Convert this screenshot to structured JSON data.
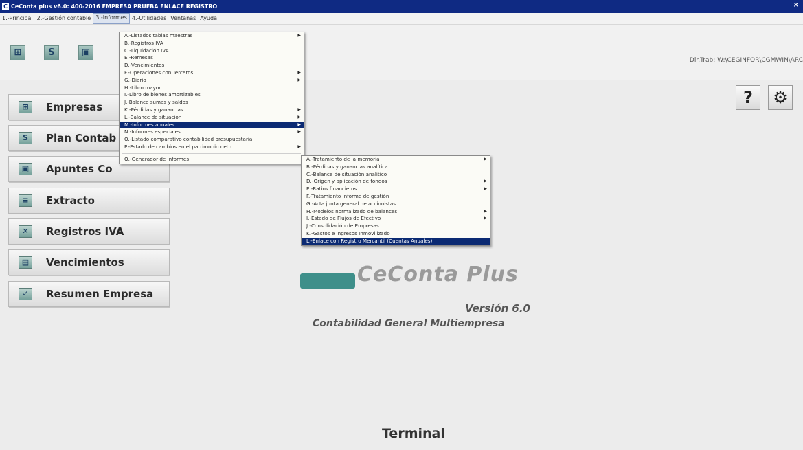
{
  "window": {
    "title": "CeConta plus v6.0: 400-2016 EMPRESA PRUEBA ENLACE REGISTRO",
    "icon_letter": "C",
    "close": "×"
  },
  "menubar": [
    "1.-Principal",
    "2.-Gestión contable",
    "3.-Informes",
    "4.-Utilidades",
    "Ventanas",
    "Ayuda"
  ],
  "toolbar": {
    "buttons": [
      {
        "icon": "empresas-icon",
        "glyph": "⊞"
      },
      {
        "icon": "plan-contable-icon",
        "glyph": "S"
      },
      {
        "icon": "apuntes-icon",
        "glyph": "▣"
      }
    ],
    "dir_trab": "Dir.Trab: W:\\CEGINFOR\\CGMWIN\\ARC"
  },
  "sidebar": [
    {
      "label": "Empresas",
      "icon": "empresas-icon",
      "glyph": "⊞"
    },
    {
      "label": "Plan Contab",
      "icon": "plan-contable-icon",
      "glyph": "S"
    },
    {
      "label": "Apuntes Co",
      "icon": "apuntes-icon",
      "glyph": "▣"
    },
    {
      "label": "Extracto",
      "icon": "extracto-icon",
      "glyph": "≡"
    },
    {
      "label": "Registros IVA",
      "icon": "registros-iva-icon",
      "glyph": "✕"
    },
    {
      "label": "Vencimientos",
      "icon": "vencimientos-icon",
      "glyph": "▤"
    },
    {
      "label": "Resumen Empresa",
      "icon": "resumen-icon",
      "glyph": "✓"
    }
  ],
  "top_right": [
    {
      "icon": "help-icon",
      "glyph": "?"
    },
    {
      "icon": "settings-icon",
      "glyph": "⚙"
    }
  ],
  "branding": {
    "logo_text": "CeConta Plus",
    "version": "Versión 6.0",
    "subtitle": "Contabilidad General Multiempresa",
    "terminal": "Terminal"
  },
  "informes_menu": {
    "items": [
      {
        "label": "A.-Listados tablas maestras",
        "submenu": true
      },
      {
        "label": "B.-Registros IVA",
        "submenu": false
      },
      {
        "label": "C.-Liquidación IVA",
        "submenu": false
      },
      {
        "label": "E.-Remesas",
        "submenu": false
      },
      {
        "label": "D.-Vencimientos",
        "submenu": false
      },
      {
        "label": "F.-Operaciones con Terceros",
        "submenu": true
      },
      {
        "label": "G.-Diario",
        "submenu": true
      },
      {
        "label": "H.-Libro mayor",
        "submenu": false
      },
      {
        "label": "I.-Libro de bienes amortizables",
        "submenu": false
      },
      {
        "label": "J.-Balance sumas y saldos",
        "submenu": false
      },
      {
        "label": "K.-Pérdidas y ganancias",
        "submenu": true
      },
      {
        "label": "L.-Balance de situación",
        "submenu": true
      },
      {
        "label": "M.-Informes anuales",
        "submenu": true,
        "selected": true
      },
      {
        "label": "N.-Informes especiales",
        "submenu": true
      },
      {
        "label": "O.-Listado comparativo contabilidad presupuestaria",
        "submenu": false
      },
      {
        "label": "P.-Estado de cambios en el patrimonio neto",
        "submenu": true
      }
    ],
    "footer": "Q.-Generador de informes"
  },
  "anuales_menu": {
    "items": [
      {
        "label": "A.-Tratamiento de la memoria",
        "submenu": true
      },
      {
        "label": "B.-Pérdidas y ganancias analítica",
        "submenu": false
      },
      {
        "label": "C.-Balance de situación analítico",
        "submenu": false
      },
      {
        "label": "D.-Origen y aplicación de fondos",
        "submenu": true
      },
      {
        "label": "E.-Ratios financieros",
        "submenu": true
      },
      {
        "label": "F.-Tratamiento informe de gestión",
        "submenu": false
      },
      {
        "label": "G.-Acta junta general de accionistas",
        "submenu": false
      },
      {
        "label": "H.-Modelos normalizado de balances",
        "submenu": true
      },
      {
        "label": "I.-Estado de Flujos de Efectivo",
        "submenu": true
      },
      {
        "label": "J.-Consolidación de Empresas",
        "submenu": false
      },
      {
        "label": "K.-Gastos e Ingresos Inmovilizado",
        "submenu": false
      },
      {
        "label": "L.-Enlace con Registro Mercantil (Cuentas Anuales)",
        "submenu": false,
        "selected": true
      }
    ]
  },
  "colors": {
    "selection": "#0b2a73",
    "titlebar": "#0f2a83",
    "icon_accent": "#6f9893"
  }
}
